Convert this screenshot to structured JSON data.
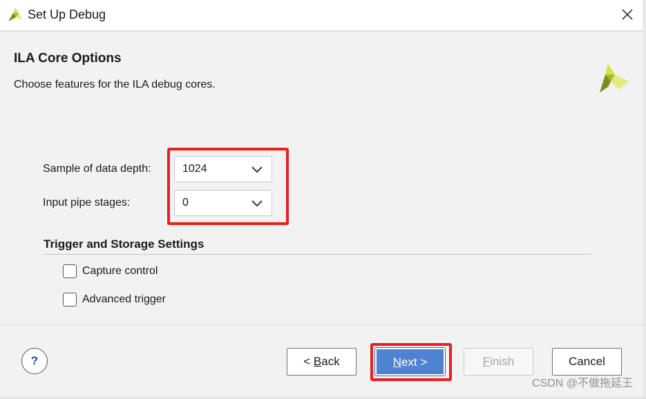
{
  "window": {
    "title": "Set Up Debug"
  },
  "header": {
    "title": "ILA Core Options",
    "subtitle": "Choose features for the ILA debug cores."
  },
  "fields": {
    "sample_depth": {
      "label": "Sample of data depth:",
      "value": "1024"
    },
    "pipe_stages": {
      "label": "Input pipe stages:",
      "value": "0"
    }
  },
  "trigger_section": {
    "title": "Trigger and Storage Settings",
    "options": [
      {
        "label": "Capture control",
        "checked": false
      },
      {
        "label": "Advanced trigger",
        "checked": false
      }
    ]
  },
  "footer": {
    "help_label": "?",
    "back_prefix": "< ",
    "back_mnemonic": "B",
    "back_rest": "ack",
    "next_mnemonic": "N",
    "next_rest": "ext >",
    "finish_mnemonic": "F",
    "finish_rest": "inish",
    "cancel_label": "Cancel",
    "watermark": "CSDN @不做拖延王"
  },
  "colors": {
    "highlight": "#e8201c",
    "primary_button": "#4f82d0",
    "logo_light": "#d9e85a",
    "logo_dark": "#8a9a1e"
  },
  "icons": {
    "window_logo": "xilinx-logo-icon",
    "header_logo": "xilinx-logo-icon",
    "close": "close-icon",
    "dropdown": "chevron-down-icon",
    "help": "help-icon"
  }
}
